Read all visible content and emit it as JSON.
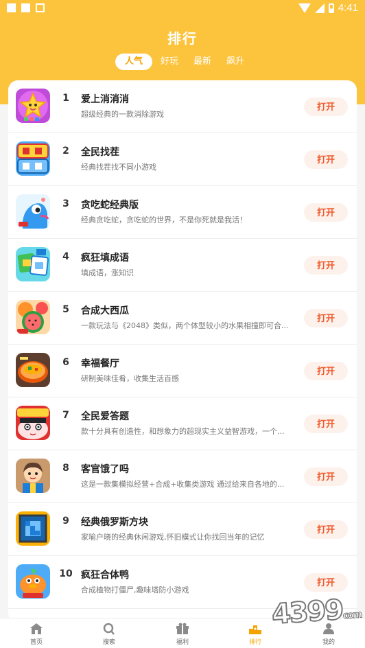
{
  "statusbar": {
    "time": "4:41"
  },
  "header": {
    "title": "排行",
    "tabs": [
      {
        "label": "人气",
        "active": true
      },
      {
        "label": "好玩",
        "active": false
      },
      {
        "label": "最新",
        "active": false
      },
      {
        "label": "飙升",
        "active": false
      }
    ]
  },
  "list": {
    "button_label": "打开",
    "items": [
      {
        "rank": "1",
        "name": "爱上消消消",
        "desc": "超级经典的一款消除游戏",
        "icon": "star-candy-icon"
      },
      {
        "rank": "2",
        "name": "全民找茬",
        "desc": "经典找茬找不同小游戏",
        "icon": "find-difference-icon"
      },
      {
        "rank": "3",
        "name": "贪吃蛇经典版",
        "desc": "经典贪吃蛇，贪吃蛇的世界，不是你死就是我活！",
        "icon": "snake-icon"
      },
      {
        "rank": "4",
        "name": "疯狂填成语",
        "desc": "填成语，涨知识",
        "icon": "idiom-icon"
      },
      {
        "rank": "5",
        "name": "合成大西瓜",
        "desc": "一款玩法与《2048》类似，两个体型较小的水果相撞即可合...",
        "icon": "watermelon-icon"
      },
      {
        "rank": "6",
        "name": "幸福餐厅",
        "desc": "研制美味佳肴，收集生活百感",
        "icon": "restaurant-icon"
      },
      {
        "rank": "7",
        "name": "全民爱答题",
        "desc": "款十分具有创造性，和想象力的超现实主义益智游戏，一个...",
        "icon": "quiz-face-icon"
      },
      {
        "rank": "8",
        "name": "客官饿了吗",
        "desc": "这是一款集模拟经营+合成+收集类游戏 通过给来自各地的...",
        "icon": "innkeeper-icon"
      },
      {
        "rank": "9",
        "name": "经典俄罗斯方块",
        "desc": "家喻户晓的经典休闲游戏,怀旧模式让你找回当年的记忆",
        "icon": "tetris-icon"
      },
      {
        "rank": "10",
        "name": "疯狂合体鸭",
        "desc": "合成植物打僵尸,趣味塔防小游戏",
        "icon": "duck-icon"
      }
    ]
  },
  "tabbar": {
    "items": [
      {
        "label": "首页",
        "icon": "home-icon"
      },
      {
        "label": "搜索",
        "icon": "search-icon"
      },
      {
        "label": "福利",
        "icon": "gift-icon"
      },
      {
        "label": "排行",
        "icon": "ranking-icon",
        "active": true
      },
      {
        "label": "我的",
        "icon": "profile-icon"
      }
    ]
  },
  "watermark": {
    "text": "4399",
    "sub": "com"
  },
  "colors": {
    "header": "#fcc33c",
    "button_text": "#f2582a",
    "button_bg": "#fdf1ec",
    "active_tab": "#f5a300"
  }
}
